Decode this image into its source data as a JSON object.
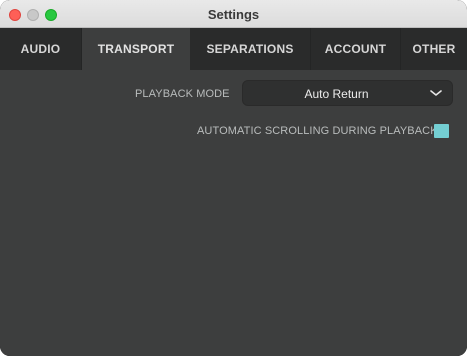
{
  "window": {
    "title": "Settings"
  },
  "tabs": [
    {
      "label": "AUDIO",
      "active": false
    },
    {
      "label": "TRANSPORT",
      "active": true
    },
    {
      "label": "SEPARATIONS",
      "active": false
    },
    {
      "label": "ACCOUNT",
      "active": false
    },
    {
      "label": "OTHER",
      "active": false
    }
  ],
  "transport": {
    "playback_mode_label": "PLAYBACK MODE",
    "playback_mode_value": "Auto Return",
    "auto_scroll_label": "AUTOMATIC SCROLLING DURING PLAYBACK",
    "auto_scroll_checked": true
  },
  "colors": {
    "accent": "#74cfd3",
    "background": "#3d3e3e",
    "tabbar": "#2a2b2b",
    "close": "#fe5f57",
    "maximize": "#28c840"
  },
  "icons": [
    "close-icon",
    "minimize-icon",
    "maximize-icon",
    "chevron-down-icon"
  ]
}
